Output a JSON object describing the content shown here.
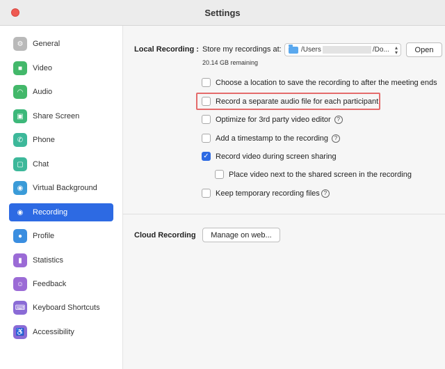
{
  "window": {
    "title": "Settings"
  },
  "sidebar": {
    "items": [
      {
        "label": "General",
        "icon": "gear-icon",
        "color": "#b9b9b9",
        "glyph": "⚙"
      },
      {
        "label": "Video",
        "icon": "video-camera-icon",
        "color": "#43b86a",
        "glyph": "■"
      },
      {
        "label": "Audio",
        "icon": "headphones-icon",
        "color": "#43b86a",
        "glyph": "◠"
      },
      {
        "label": "Share Screen",
        "icon": "share-screen-icon",
        "color": "#3db87a",
        "glyph": "▣"
      },
      {
        "label": "Phone",
        "icon": "phone-icon",
        "color": "#3db89a",
        "glyph": "✆"
      },
      {
        "label": "Chat",
        "icon": "chat-bubble-icon",
        "color": "#3db89a",
        "glyph": "▢"
      },
      {
        "label": "Virtual Background",
        "icon": "person-background-icon",
        "color": "#3a9bd8",
        "glyph": "◉"
      },
      {
        "label": "Recording",
        "icon": "record-icon",
        "color": "#2d6ae3",
        "glyph": "◉"
      },
      {
        "label": "Profile",
        "icon": "profile-icon",
        "color": "#3a8ee0",
        "glyph": "●"
      },
      {
        "label": "Statistics",
        "icon": "bar-chart-icon",
        "color": "#9b6bd6",
        "glyph": "▮"
      },
      {
        "label": "Feedback",
        "icon": "feedback-icon",
        "color": "#9b6bd6",
        "glyph": "☺"
      },
      {
        "label": "Keyboard Shortcuts",
        "icon": "keyboard-icon",
        "color": "#8a6bd6",
        "glyph": "⌨"
      },
      {
        "label": "Accessibility",
        "icon": "accessibility-icon",
        "color": "#8a6bd6",
        "glyph": "♿"
      }
    ],
    "active_index": 7
  },
  "local": {
    "section_label": "Local Recording :",
    "store_label": "Store my recordings at:",
    "path_prefix": "/Users",
    "path_suffix": "/Do...",
    "open_button": "Open",
    "remaining": "20.14 GB remaining",
    "options": [
      {
        "label": "Choose a location to save the recording to after the meeting ends",
        "checked": false,
        "help": false
      },
      {
        "label": "Record a separate audio file for each participant",
        "checked": false,
        "help": false
      },
      {
        "label": "Optimize for 3rd party video editor",
        "checked": false,
        "help": true
      },
      {
        "label": "Add a timestamp to the recording",
        "checked": false,
        "help": true
      },
      {
        "label": "Record video during screen sharing",
        "checked": true,
        "help": false
      },
      {
        "label": "Place video next to the shared screen in the recording",
        "checked": false,
        "help": false
      },
      {
        "label": "Keep temporary recording files",
        "checked": false,
        "help": true
      }
    ]
  },
  "cloud": {
    "section_label": "Cloud Recording",
    "manage_button": "Manage on web..."
  },
  "colors": {
    "accent": "#2d6ae3",
    "highlight": "#e46b6b"
  }
}
